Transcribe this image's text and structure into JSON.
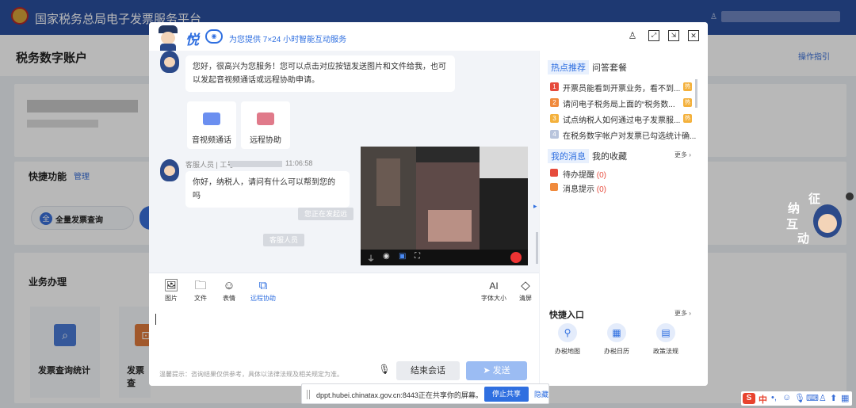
{
  "header": {
    "site_title": "国家税务总局电子发票服务平台"
  },
  "page": {
    "account_title": "税务数字账户",
    "guide_link": "操作指引",
    "quick_functions": "快捷功能",
    "manage": "管理",
    "pill_invoice_query": "全量发票查询",
    "business": "业务办理",
    "tiles": [
      "发票查询统计",
      "发票查"
    ]
  },
  "assistant": {
    "brand": "悦",
    "tagline": "为您提供 7×24 小时智能互动服务",
    "welcome": "您好，很高兴为您服务！您可以点击对应按钮发送图片和文件给我，也可以发起音视频通话或远程协助申请。",
    "options": [
      {
        "label": "音视频通话",
        "color": "#6b8ff0"
      },
      {
        "label": "远程协助",
        "color": "#e07a8a"
      }
    ],
    "agent_label": "客服人员 | 工号",
    "agent_time": "11:06:58",
    "agent_msg": "你好，纳税人，请问有什么可以帮到您的吗",
    "system1": "您正在发起远",
    "system2": "客服人员",
    "tools": [
      {
        "label": "图片",
        "icon": "image-icon",
        "glyph": "🖼"
      },
      {
        "label": "文件",
        "icon": "folder-icon",
        "glyph": "🗀"
      },
      {
        "label": "表情",
        "icon": "emoji-icon",
        "glyph": "☺"
      },
      {
        "label": "远程协助",
        "icon": "remote-icon",
        "glyph": "⧉"
      }
    ],
    "font_size": "字体大小",
    "font_glyph": "AI",
    "clear": "清屏",
    "clear_glyph": "◇",
    "input_value": "",
    "tip": "温馨提示：咨询结果仅供参考，具体以法律法规及相关规定为准。",
    "end_chat": "结束会话",
    "send": "发送",
    "send_glyph": "➤"
  },
  "right": {
    "tab_hot": "热点推荐",
    "tab_qa": "问答套餐",
    "more": "更多",
    "hot_items": [
      {
        "n": "1",
        "text": "开票员能看到开票业务，看不到...",
        "color": "#e64b3c"
      },
      {
        "n": "2",
        "text": "请问电子税务局上面的“税务数...",
        "color": "#f08a3c"
      },
      {
        "n": "3",
        "text": "试点纳税人如何通过电子发票服...",
        "color": "#f4b13c"
      },
      {
        "n": "4",
        "text": "在税务数字帐户对发票已勾选统计确...",
        "color": "#b8c4dc"
      }
    ],
    "hot_badge": "热",
    "tab_msg": "我的消息",
    "tab_fav": "我的收藏",
    "messages": [
      {
        "label": "待办提醒",
        "count": "(0)",
        "color": "#e64b3c"
      },
      {
        "label": "消息提示",
        "count": "(0)",
        "color": "#f08a3c"
      }
    ],
    "quick_entry": "快捷入口",
    "quick": [
      {
        "label": "办税地图",
        "glyph": "⚲"
      },
      {
        "label": "办税日历",
        "glyph": "▦"
      },
      {
        "label": "政策法规",
        "glyph": "▤"
      }
    ]
  },
  "share_bar": {
    "text": "dppt.hubei.chinatax.gov.cn:8443正在共享你的屏幕。",
    "stop": "停止共享",
    "hide": "隐藏"
  },
  "mascot": {
    "chars": [
      "征",
      "纳",
      "互",
      "动"
    ]
  }
}
